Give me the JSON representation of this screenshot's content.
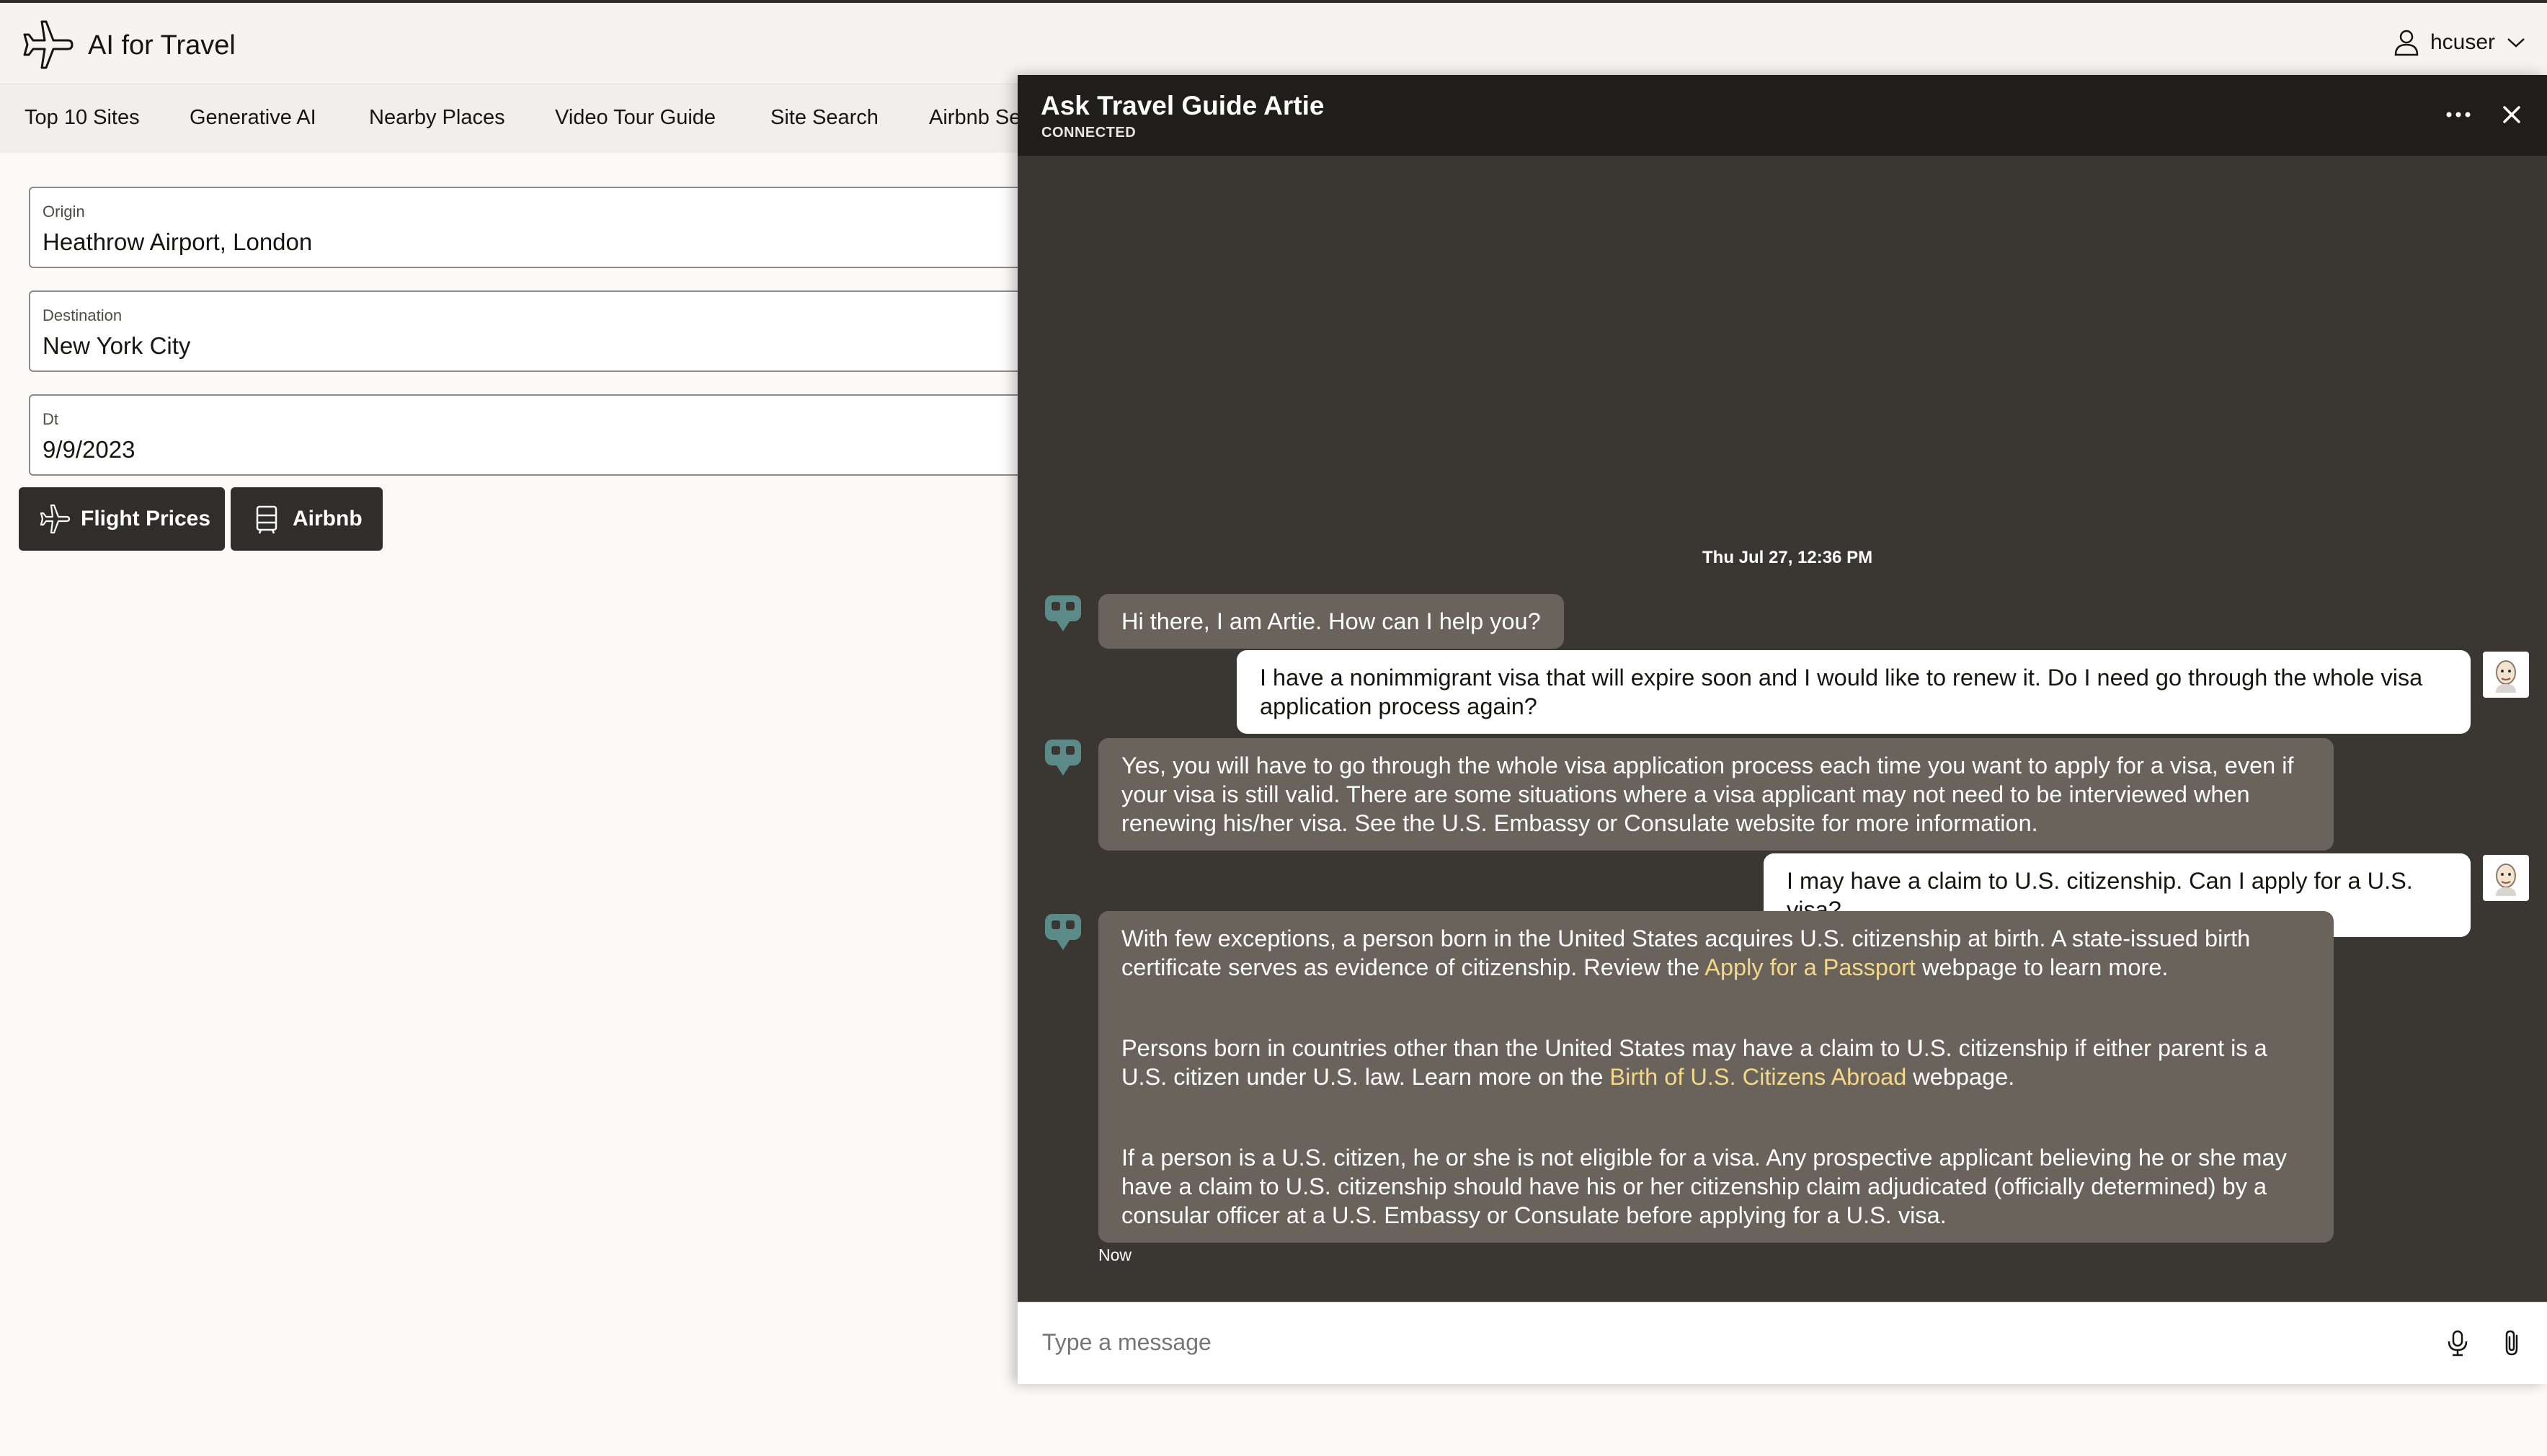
{
  "header": {
    "app_title": "AI for Travel",
    "user_name": "hcuser"
  },
  "nav": {
    "items": [
      {
        "label": "Top 10 Sites"
      },
      {
        "label": "Generative AI"
      },
      {
        "label": "Nearby Places"
      },
      {
        "label": "Video Tour Guide"
      },
      {
        "label": "Site Search"
      },
      {
        "label": "Airbnb Se"
      }
    ]
  },
  "form": {
    "origin": {
      "label": "Origin",
      "value": "Heathrow Airport, London"
    },
    "destination": {
      "label": "Destination",
      "value": "New York City"
    },
    "date": {
      "label": "Dt",
      "value": "9/9/2023"
    },
    "flight_button": "Flight Prices",
    "airbnb_button": "Airbnb"
  },
  "chat": {
    "title": "Ask Travel Guide Artie",
    "status": "CONNECTED",
    "timestamp": "Thu Jul 27, 12:36 PM",
    "messages": {
      "m1": "Hi there, I am Artie. How can I help you?",
      "m2": "I have a nonimmigrant visa that will expire soon and I would like to renew it. Do I need go through the whole visa application process again?",
      "m3": "Yes, you will have to go through the whole visa application process each time you want to apply for a visa, even if your visa is still valid. There are some situations where a visa applicant may not need to be interviewed when renewing his/her visa. See the U.S. Embassy or Consulate website for more information.",
      "m4": "I may have a claim to U.S. citizenship. Can I apply for a U.S. visa?",
      "m5": {
        "p1_a": "With few exceptions, a person born in the United States acquires U.S. citizenship at birth. A state-issued birth certificate serves as evidence of citizenship. Review the ",
        "p1_link": "Apply for a Passport",
        "p1_b": " webpage to learn more.",
        "p2_a": "Persons born in countries other than the United States may have a claim to U.S. citizenship if either parent is a U.S. citizen under U.S. law. Learn more on the ",
        "p2_link": "Birth of U.S. Citizens Abroad",
        "p2_b": " webpage.",
        "p3": "If a person is a U.S. citizen, he or she is not eligible for a visa. Any prospective applicant believing he or she may have a claim to U.S. citizenship should have his or her citizenship claim adjudicated (officially determined) by a consular officer at a U.S. Embassy or Consulate before applying for a U.S. visa."
      }
    },
    "now_label": "Now",
    "composer_placeholder": "Type a message"
  },
  "colors": {
    "chat_bg": "#3a3631",
    "chat_header": "#201e1c",
    "bot_bubble": "#6a635c",
    "link": "#f4d88a",
    "bot_avatar": "#5c8a88",
    "button": "#312d2a"
  },
  "icons": [
    "airplane-icon",
    "user-icon",
    "chevron-down-icon",
    "more-icon",
    "close-icon",
    "bot-icon",
    "user-avatar-icon",
    "microphone-icon",
    "attachment-icon"
  ]
}
